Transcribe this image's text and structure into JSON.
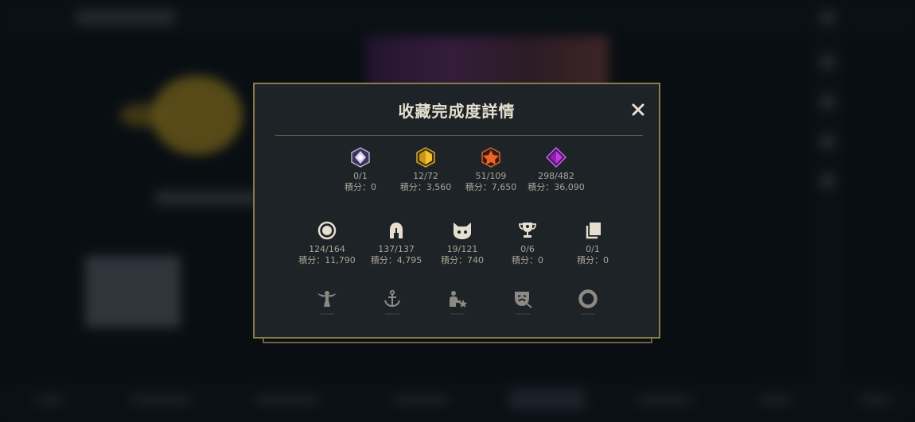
{
  "modal": {
    "title": "收藏完成度詳情",
    "close_icon": "close-icon",
    "row1": [
      {
        "icon": "chroma-gem-icon",
        "count": "0/1",
        "score": "積分：0",
        "color": "#c9b6ff"
      },
      {
        "icon": "gold-gem-icon",
        "count": "12/72",
        "score": "積分：3,560",
        "color": "#f2c230"
      },
      {
        "icon": "orange-gem-icon",
        "count": "51/109",
        "score": "積分：7,650",
        "color": "#e8642a"
      },
      {
        "icon": "purple-gem-icon",
        "count": "298/482",
        "score": "積分：36,090",
        "color": "#c13ce0"
      }
    ],
    "row2": [
      {
        "icon": "ring-icon",
        "count": "124/164",
        "score": "積分：11,790"
      },
      {
        "icon": "helmet-icon",
        "count": "137/137",
        "score": "積分：4,795"
      },
      {
        "icon": "cat-face-icon",
        "count": "19/121",
        "score": "積分：740"
      },
      {
        "icon": "trophy-icon",
        "count": "0/6",
        "score": "積分：0"
      },
      {
        "icon": "cards-icon",
        "count": "0/1",
        "score": "積分：0"
      }
    ],
    "row3": [
      {
        "icon": "winged-figure-icon"
      },
      {
        "icon": "anchor-icon"
      },
      {
        "icon": "figure-star-icon"
      },
      {
        "icon": "theater-mask-icon"
      },
      {
        "icon": "circle-ring-icon"
      }
    ]
  }
}
